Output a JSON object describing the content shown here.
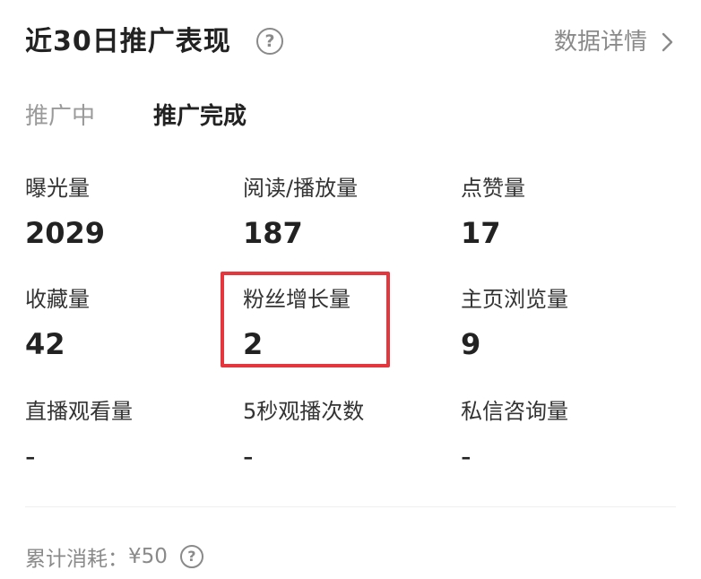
{
  "header": {
    "title": "近30日推广表现",
    "help_icon": "question-circle-icon",
    "detail_link": "数据详情",
    "detail_icon": "chevron-right-icon"
  },
  "tabs": [
    {
      "label": "推广中",
      "active": false
    },
    {
      "label": "推广完成",
      "active": true
    }
  ],
  "metrics": [
    {
      "label": "曝光量",
      "value": "2029"
    },
    {
      "label": "阅读/播放量",
      "value": "187"
    },
    {
      "label": "点赞量",
      "value": "17"
    },
    {
      "label": "收藏量",
      "value": "42"
    },
    {
      "label": "粉丝增长量",
      "value": "2",
      "highlighted": true
    },
    {
      "label": "主页浏览量",
      "value": "9"
    },
    {
      "label": "直播观看量",
      "value": "-"
    },
    {
      "label": "5秒观播次数",
      "value": "-"
    },
    {
      "label": "私信咨询量",
      "value": "-"
    }
  ],
  "footer": {
    "cost_label": "累计消耗：",
    "cost_value": "¥50",
    "help_icon": "question-circle-icon"
  },
  "colors": {
    "highlight_border": "#e4363c",
    "muted_text": "#8a8a8a",
    "primary_text": "#222222"
  }
}
